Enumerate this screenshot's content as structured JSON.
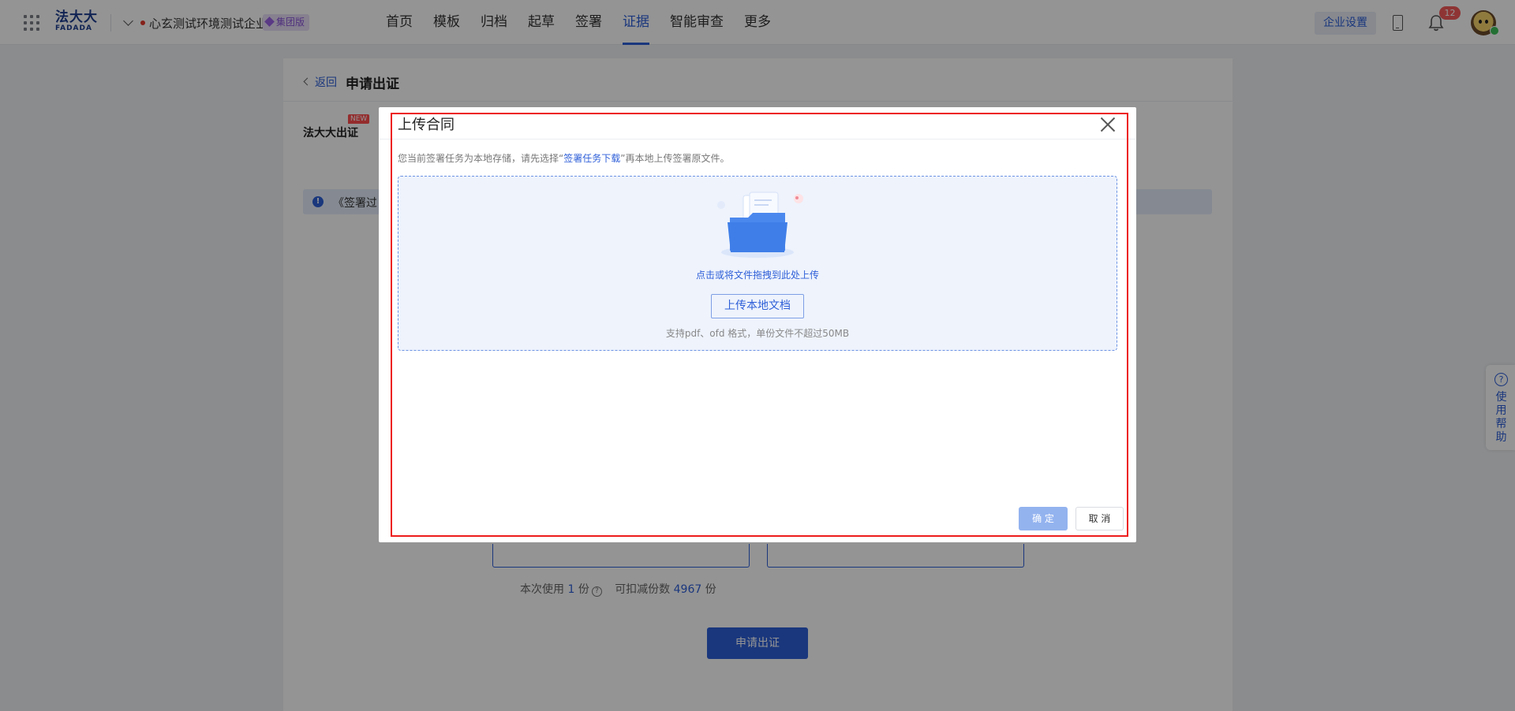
{
  "header": {
    "logo_cn": "法大大",
    "logo_en": "FADADA",
    "company": "心玄测试环境测试企业",
    "edition_badge": "集团版",
    "nav": [
      {
        "label": "首页"
      },
      {
        "label": "模板"
      },
      {
        "label": "归档"
      },
      {
        "label": "起草"
      },
      {
        "label": "签署"
      },
      {
        "label": "证据",
        "active": true
      },
      {
        "label": "智能审查"
      },
      {
        "label": "更多"
      }
    ],
    "settings_label": "企业设置",
    "notification_count": "12"
  },
  "page": {
    "back_label": "返回",
    "title": "申请出证",
    "tab_label": "法大大出证",
    "new_badge": "NEW",
    "notice_text": "《签署过",
    "usage_prefix": "本次使用",
    "usage_count": "1",
    "usage_unit": "份",
    "deductible_prefix": "可扣减份数",
    "deductible_count": "4967",
    "deductible_unit": "份",
    "apply_button": "申请出证"
  },
  "help": {
    "icon": "?",
    "label": "使用帮助"
  },
  "modal": {
    "title": "上传合同",
    "hint_before": "您当前签署任务为本地存储，请先选择“",
    "hint_link": "签署任务下载",
    "hint_after": "”再本地上传签署原文件。",
    "drop_text": "点击或将文件拖拽到此处上传",
    "upload_button": "上传本地文档",
    "support_text": "支持pdf、ofd 格式，单份文件不超过50MB",
    "confirm_button": "确 定",
    "cancel_button": "取 消"
  },
  "colors": {
    "primary": "#2e5fd8",
    "highlight": "#ee1c1c",
    "badge_red": "#f45b5b"
  }
}
